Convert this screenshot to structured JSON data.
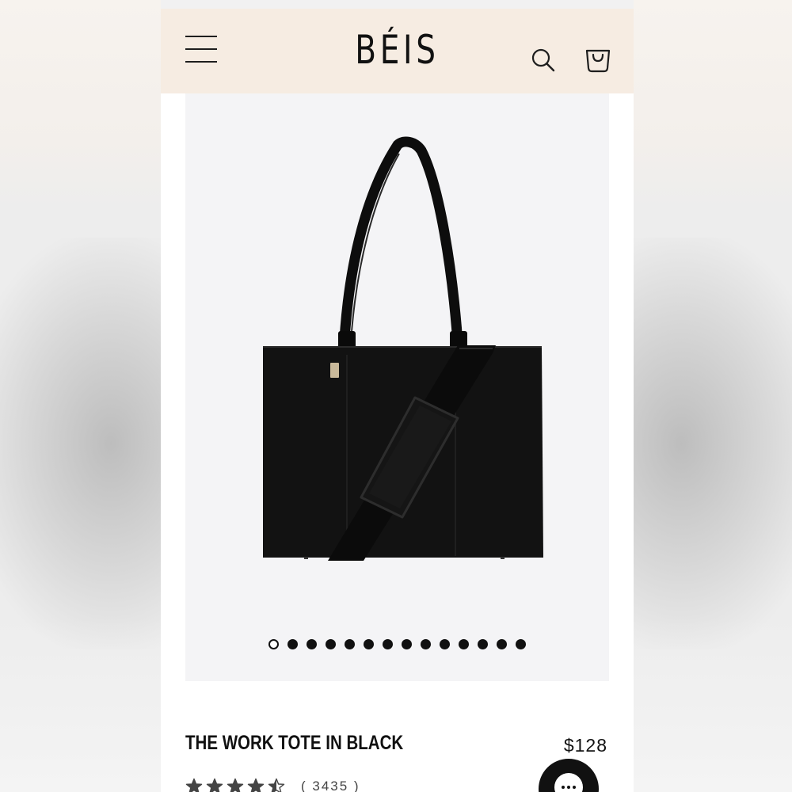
{
  "header": {
    "menu_icon": "hamburger-menu-icon",
    "brand": "BÉIS",
    "search_icon": "search-icon",
    "cart_icon": "shopping-bag-icon",
    "background": "#f6ece2"
  },
  "gallery": {
    "image_alt": "The Work Tote in Black",
    "slide_count": 14,
    "active_slide": 1
  },
  "product": {
    "title": "THE WORK TOTE IN BLACK",
    "price": "$128",
    "rating": 4.5,
    "review_count": "( 3435 )"
  },
  "chat": {
    "icon": "chat-bubble-icon"
  }
}
